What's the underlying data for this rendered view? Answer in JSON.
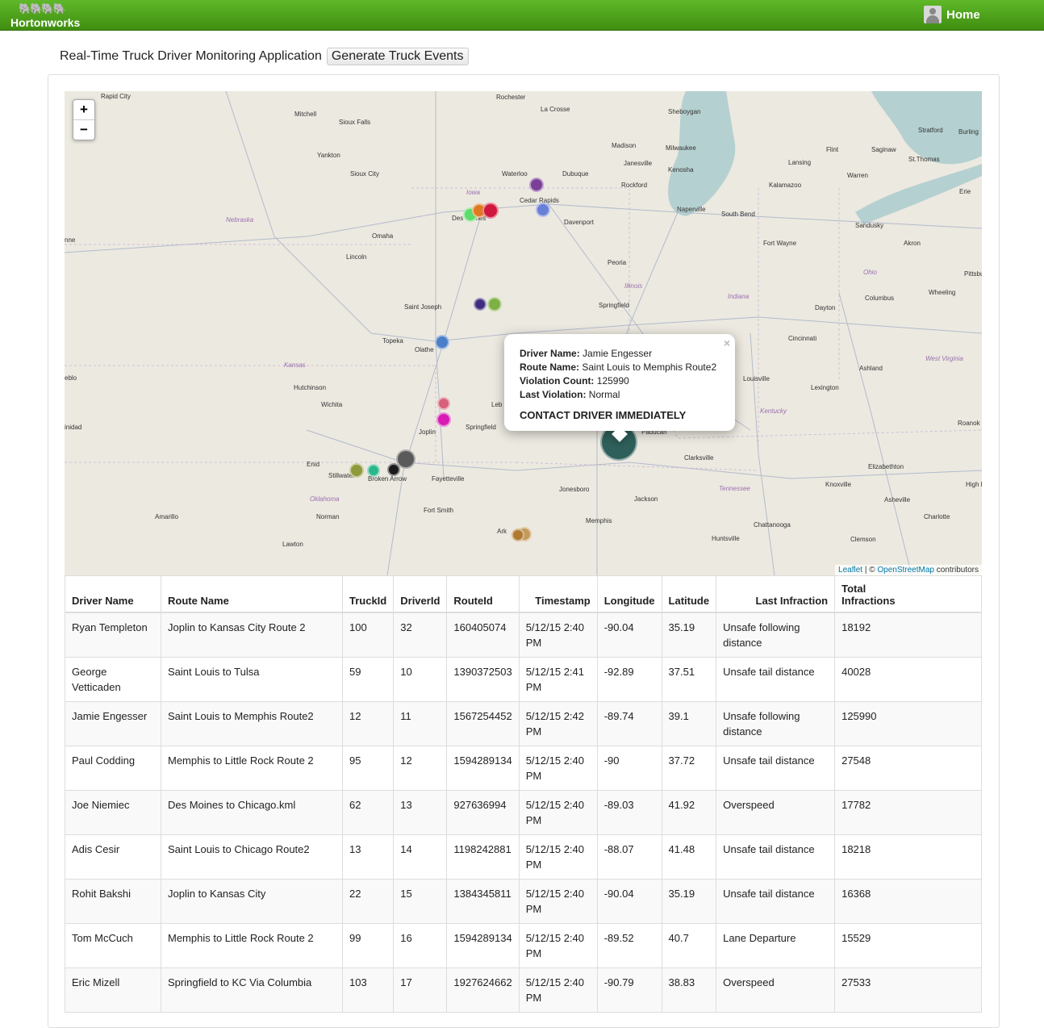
{
  "topbar": {
    "brand": "Hortonworks",
    "home_label": "Home"
  },
  "header": {
    "title": "Real-Time Truck Driver Monitoring Application",
    "generate_button": "Generate Truck Events"
  },
  "map": {
    "zoom_in": "+",
    "zoom_out": "−",
    "attribution": {
      "leaflet": "Leaflet",
      "separator": " | © ",
      "osm": "OpenStreetMap",
      "suffix": " contributors"
    },
    "cities": [
      "Rapid City",
      "Rochester",
      "La Crosse",
      "Sheboygan",
      "Mitchell",
      "Sioux Falls",
      "Madison",
      "Milwaukee",
      "Flint",
      "Saginaw",
      "Stratford",
      "Burling",
      "Yankton",
      "Janesville",
      "Kenosha",
      "Lansing",
      "Warren",
      "St.Thomas",
      "Sioux City",
      "Waterloo",
      "Dubuque",
      "Rockford",
      "Kalamazoo",
      "Erie",
      "Cedar Rapids",
      "Naperville",
      "South Bend",
      "Des Moines",
      "Davenport",
      "Sandusky",
      "Omaha",
      "Fort Wayne",
      "Akron",
      "Lincoln",
      "Peoria",
      "Pittsburg",
      "Columbus",
      "Wheeling",
      "Saint Joseph",
      "Springfield",
      "Dayton",
      "Topeka",
      "Olathe",
      "Cincinnati",
      "Hutchinson",
      "Louisville",
      "Ashland",
      "Lexington",
      "Wichita",
      "Leb",
      "Paducah",
      "Roanok",
      "Joplin",
      "Springfield",
      "Clarksville",
      "Elizabethton",
      "Enid",
      "Stillwater",
      "Broken Arrow",
      "Fayetteville",
      "Jonesboro",
      "Knoxville",
      "High Poi",
      "Jackson",
      "Asheville",
      "Fort Smith",
      "Amarillo",
      "Norman",
      "Memphis",
      "Charlotte",
      "Chattanooga",
      "Huntsville",
      "Clemson",
      "Lawton",
      "Ark",
      "nne",
      "eblo",
      "inidad"
    ],
    "states": [
      "Iowa",
      "Nebraska",
      "Illinois",
      "Indiana",
      "Ohio",
      "Kansas",
      "West Virginia",
      "Kentucky",
      "Tennessee",
      "Oklahoma"
    ],
    "marker_colors": [
      "#7b3f98",
      "#5cdc6a",
      "#e07a20",
      "#d0183c",
      "#6a7fd8",
      "#3f2e80",
      "#7fb045",
      "#4a7fc8",
      "#d8607a",
      "#d81bb5",
      "#2f5f5a",
      "#5a5a5a",
      "#1a1a1a",
      "#2ab88a",
      "#8e9a3a",
      "#c49a5a",
      "#b07a30"
    ],
    "popup": {
      "driver_label": "Driver Name:",
      "driver_value": "Jamie Engesser",
      "route_label": "Route Name:",
      "route_value": "Saint Louis to Memphis Route2",
      "count_label": "Violation Count:",
      "count_value": "125990",
      "last_label": "Last Violation:",
      "last_value": "Normal",
      "alert": "CONTACT DRIVER IMMEDIATELY",
      "close": "×"
    }
  },
  "table": {
    "headers": {
      "driver_name": "Driver Name",
      "route_name": "Route Name",
      "truck_id": "TruckId",
      "driver_id": "DriverId",
      "route_id": "RouteId",
      "timestamp": "Timestamp",
      "longitude": "Longitude",
      "latitude": "Latitude",
      "last_infraction": "Last Infraction",
      "total_line1": "Total",
      "total_line2": "Infractions"
    },
    "rows": [
      {
        "driver": "Ryan Templeton",
        "route": "Joplin to Kansas City Route 2",
        "truck": "100",
        "driverId": "32",
        "routeId": "160405074",
        "ts": "5/12/15 2:40 PM",
        "lon": "-90.04",
        "lat": "35.19",
        "infraction": "Unsafe following distance",
        "total": "18192"
      },
      {
        "driver": "George Vetticaden",
        "route": "Saint Louis to Tulsa",
        "truck": "59",
        "driverId": "10",
        "routeId": "1390372503",
        "ts": "5/12/15 2:41 PM",
        "lon": "-92.89",
        "lat": "37.51",
        "infraction": "Unsafe tail distance",
        "total": "40028"
      },
      {
        "driver": "Jamie Engesser",
        "route": "Saint Louis to Memphis Route2",
        "truck": "12",
        "driverId": "11",
        "routeId": "1567254452",
        "ts": "5/12/15 2:42 PM",
        "lon": "-89.74",
        "lat": "39.1",
        "infraction": "Unsafe following distance",
        "total": "125990"
      },
      {
        "driver": "Paul Codding",
        "route": "Memphis to Little Rock Route 2",
        "truck": "95",
        "driverId": "12",
        "routeId": "1594289134",
        "ts": "5/12/15 2:40 PM",
        "lon": "-90",
        "lat": "37.72",
        "infraction": "Unsafe tail distance",
        "total": "27548"
      },
      {
        "driver": "Joe Niemiec",
        "route": "Des Moines to Chicago.kml",
        "truck": "62",
        "driverId": "13",
        "routeId": "927636994",
        "ts": "5/12/15 2:40 PM",
        "lon": "-89.03",
        "lat": "41.92",
        "infraction": "Overspeed",
        "total": "17782"
      },
      {
        "driver": "Adis Cesir",
        "route": "Saint Louis to Chicago Route2",
        "truck": "13",
        "driverId": "14",
        "routeId": "1198242881",
        "ts": "5/12/15 2:40 PM",
        "lon": "-88.07",
        "lat": "41.48",
        "infraction": "Unsafe tail distance",
        "total": "18218"
      },
      {
        "driver": "Rohit Bakshi",
        "route": "Joplin to Kansas City",
        "truck": "22",
        "driverId": "15",
        "routeId": "1384345811",
        "ts": "5/12/15 2:40 PM",
        "lon": "-90.04",
        "lat": "35.19",
        "infraction": "Unsafe tail distance",
        "total": "16368"
      },
      {
        "driver": "Tom McCuch",
        "route": "Memphis to Little Rock Route 2",
        "truck": "99",
        "driverId": "16",
        "routeId": "1594289134",
        "ts": "5/12/15 2:40 PM",
        "lon": "-89.52",
        "lat": "40.7",
        "infraction": "Lane Departure",
        "total": "15529"
      },
      {
        "driver": "Eric Mizell",
        "route": "Springfield to KC Via Columbia",
        "truck": "103",
        "driverId": "17",
        "routeId": "1927624662",
        "ts": "5/12/15 2:40 PM",
        "lon": "-90.79",
        "lat": "38.83",
        "infraction": "Overspeed",
        "total": "27533"
      }
    ]
  }
}
